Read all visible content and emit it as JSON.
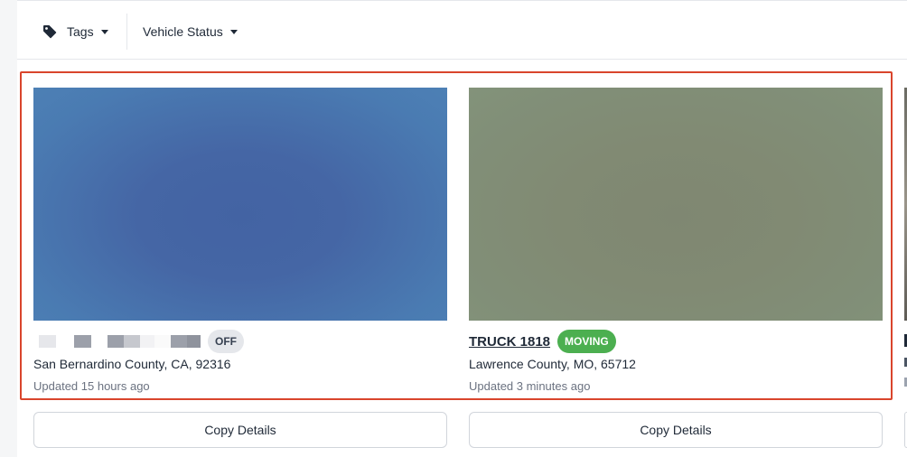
{
  "filters": {
    "tags_label": "Tags",
    "vehicle_status_label": "Vehicle Status"
  },
  "cards": [
    {
      "name": "",
      "status": "OFF",
      "location": "San Bernardino County, CA, 92316",
      "updated": "Updated 15 hours ago",
      "copy_label": "Copy Details"
    },
    {
      "name": "TRUCK 1818",
      "status": "MOVING",
      "location": "Lawrence County, MO, 65712",
      "updated": "Updated 3 minutes ago",
      "copy_label": "Copy Details"
    }
  ],
  "colors": {
    "moving_badge": "#4caf50",
    "off_badge": "#e5e7eb",
    "highlight_border": "#d9452c"
  },
  "icons": {
    "tags": "tag-icon",
    "dropdown": "caret-down-icon"
  }
}
